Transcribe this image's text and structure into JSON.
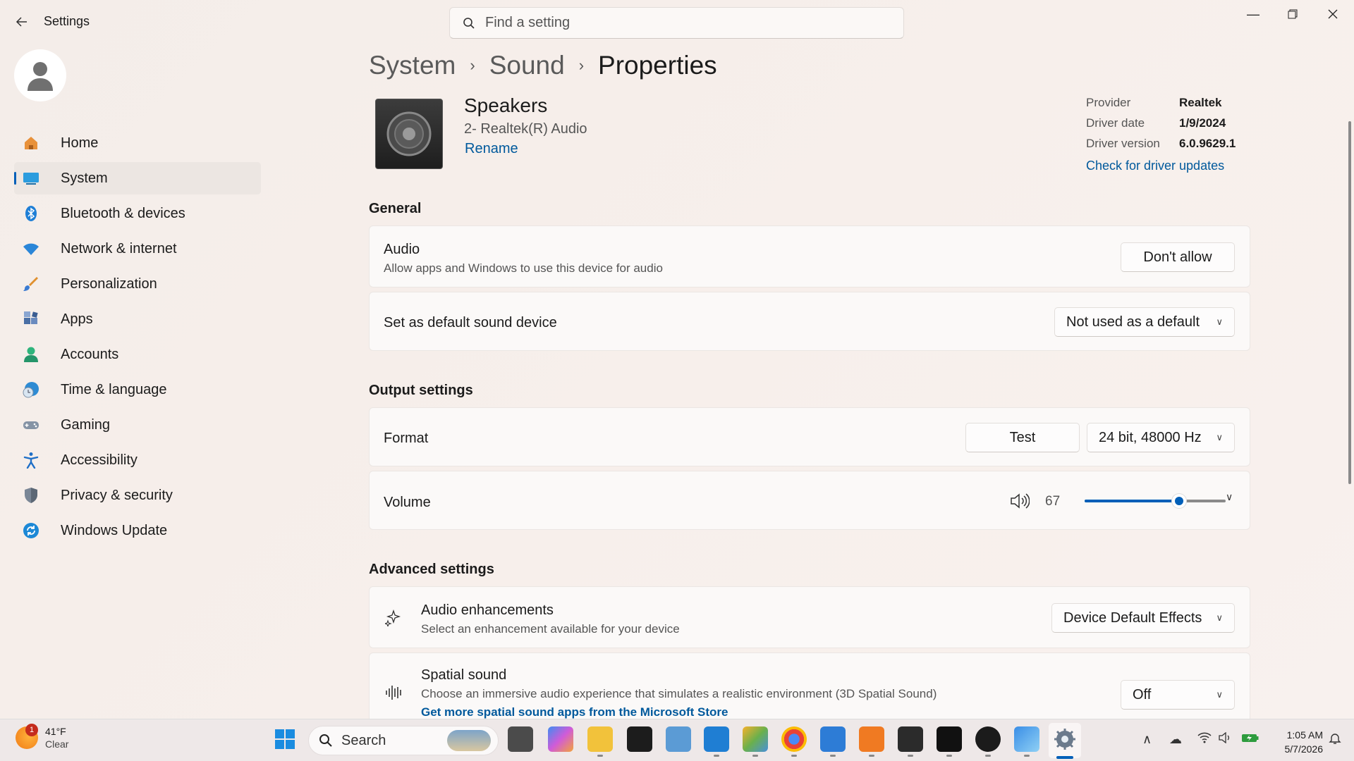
{
  "window": {
    "app_title": "Settings",
    "search_placeholder": "Find a setting"
  },
  "sidebar": {
    "items": [
      {
        "label": "Home",
        "icon": "home-icon"
      },
      {
        "label": "System",
        "icon": "system-icon",
        "active": true
      },
      {
        "label": "Bluetooth & devices",
        "icon": "bluetooth-icon"
      },
      {
        "label": "Network & internet",
        "icon": "wifi-icon"
      },
      {
        "label": "Personalization",
        "icon": "brush-icon"
      },
      {
        "label": "Apps",
        "icon": "apps-icon"
      },
      {
        "label": "Accounts",
        "icon": "accounts-icon"
      },
      {
        "label": "Time & language",
        "icon": "clock-globe-icon"
      },
      {
        "label": "Gaming",
        "icon": "gamepad-icon"
      },
      {
        "label": "Accessibility",
        "icon": "accessibility-icon"
      },
      {
        "label": "Privacy & security",
        "icon": "shield-icon"
      },
      {
        "label": "Windows Update",
        "icon": "update-icon"
      }
    ]
  },
  "breadcrumb": [
    "System",
    "Sound",
    "Properties"
  ],
  "device": {
    "name": "Speakers",
    "subtitle": "2- Realtek(R) Audio",
    "rename": "Rename"
  },
  "driver": {
    "provider_label": "Provider",
    "provider": "Realtek",
    "date_label": "Driver date",
    "date": "1/9/2024",
    "version_label": "Driver version",
    "version": "6.0.9629.1",
    "update_link": "Check for driver updates"
  },
  "general": {
    "title": "General",
    "audio_title": "Audio",
    "audio_desc": "Allow apps and Windows to use this device for audio",
    "audio_button": "Don't allow",
    "default_title": "Set as default sound device",
    "default_value": "Not used as a default"
  },
  "output": {
    "title": "Output settings",
    "format_title": "Format",
    "test_button": "Test",
    "format_value": "24 bit, 48000 Hz",
    "volume_title": "Volume",
    "volume_value": "67",
    "volume_level": 0.67
  },
  "advanced": {
    "title": "Advanced settings",
    "enh_title": "Audio enhancements",
    "enh_desc": "Select an enhancement available for your device",
    "enh_value": "Device Default Effects",
    "spatial_title": "Spatial sound",
    "spatial_desc": "Choose an immersive audio experience that simulates a realistic environment (3D Spatial Sound)",
    "spatial_link": "Get more spatial sound apps from the Microsoft Store",
    "spatial_value": "Off"
  },
  "taskbar": {
    "temp": "41°F",
    "condition": "Clear",
    "weather_badge": "1",
    "search": "Search",
    "time": "1:05 AM",
    "date": "5/7/2026"
  },
  "colors": {
    "accent": "#005fb8",
    "link": "#00599c"
  }
}
